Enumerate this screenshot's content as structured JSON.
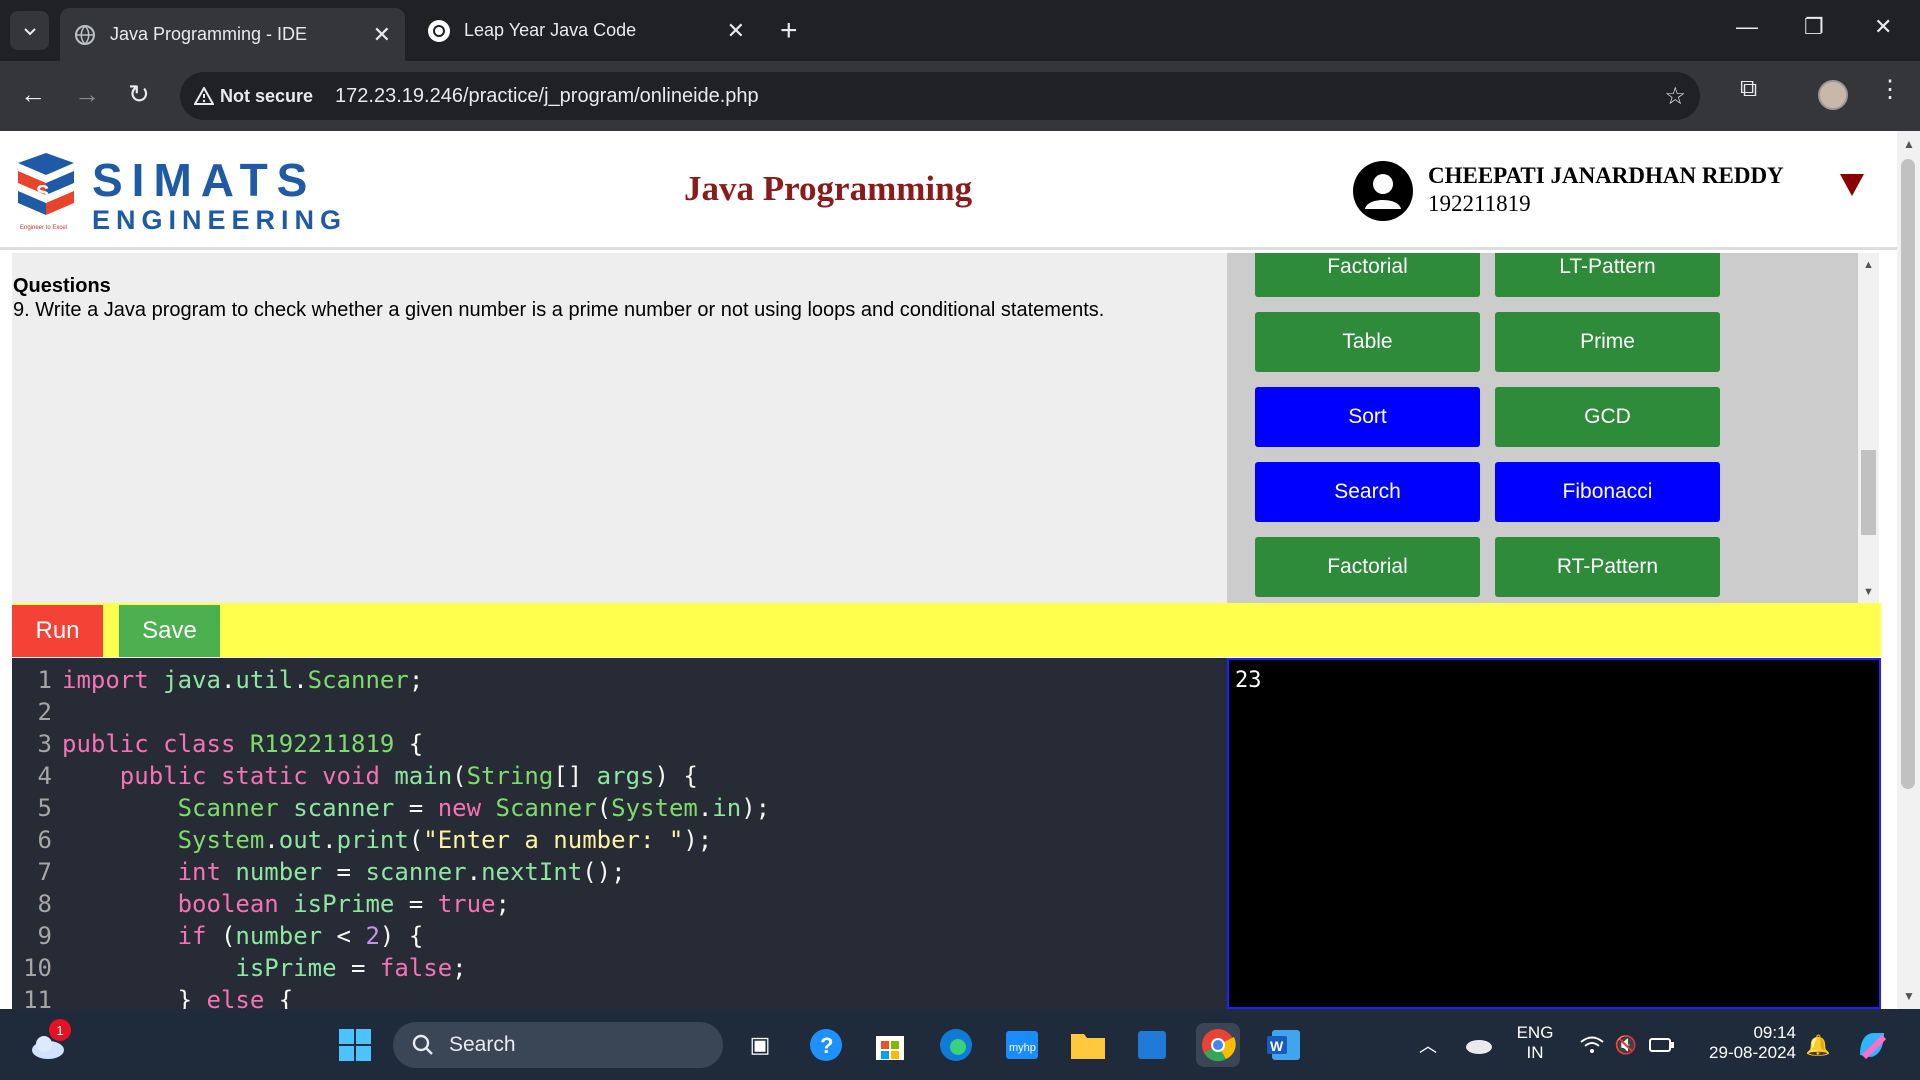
{
  "browser": {
    "tabs": [
      {
        "title": "Java Programming - IDE",
        "active": true
      },
      {
        "title": "Leap Year Java Code",
        "active": false
      }
    ],
    "security_label": "Not secure",
    "url": "172.23.19.246/practice/j_program/onlineide.php"
  },
  "header": {
    "logo_text": "SIMATS",
    "logo_subtext": "ENGINEERING",
    "logo_tagline": "Engineer to Excel",
    "title": "Java Programming",
    "user_name": "CHEEPATI JANARDHAN REDDY",
    "user_id": "192211819"
  },
  "question": {
    "heading": "Questions",
    "text": "9. Write a Java program to check whether a given number is a prime number or not using loops and conditional statements."
  },
  "program_buttons": [
    {
      "label": "Factorial",
      "color": "#2e8b3a"
    },
    {
      "label": "LT-Pattern",
      "color": "#2e8b3a"
    },
    {
      "label": "Table",
      "color": "#2e8b3a"
    },
    {
      "label": "Prime",
      "color": "#2e8b3a"
    },
    {
      "label": "Sort",
      "color": "#0000ff"
    },
    {
      "label": "GCD",
      "color": "#2e8b3a"
    },
    {
      "label": "Search",
      "color": "#0000ff"
    },
    {
      "label": "Fibonacci",
      "color": "#0000ff"
    },
    {
      "label": "Factorial",
      "color": "#2e8b3a"
    },
    {
      "label": "RT-Pattern",
      "color": "#2e8b3a"
    }
  ],
  "actions": {
    "run_label": "Run",
    "save_label": "Save"
  },
  "editor": {
    "lines": [
      {
        "n": "1",
        "html": "<span class=\"kw\">import</span> <span class=\"id\">java</span>.<span class=\"id\">util</span>.<span class=\"ty\">Scanner</span>;"
      },
      {
        "n": "2",
        "html": ""
      },
      {
        "n": "3",
        "html": "<span class=\"kw\">public</span> <span class=\"kw\">class</span> <span class=\"ty\">R192211819</span> {"
      },
      {
        "n": "4",
        "html": "    <span class=\"kw\">public</span> <span class=\"kw\">static</span> <span class=\"kw\">void</span> <span class=\"id\">main</span>(<span class=\"ty\">String</span>[] <span class=\"id\">args</span>) {"
      },
      {
        "n": "5",
        "html": "        <span class=\"ty\">Scanner</span> <span class=\"id\">scanner</span> = <span class=\"kw\">new</span> <span class=\"ty\">Scanner</span>(<span class=\"ty\">System</span>.<span class=\"id\">in</span>);"
      },
      {
        "n": "6",
        "html": "        <span class=\"ty\">System</span>.<span class=\"id\">out</span>.<span class=\"id\">print</span>(<span class=\"str\">\"Enter a number: \"</span>);"
      },
      {
        "n": "7",
        "html": "        <span class=\"kw\">int</span> <span class=\"id\">number</span> = <span class=\"id\">scanner</span>.<span class=\"id\">nextInt</span>();"
      },
      {
        "n": "8",
        "html": "        <span class=\"kw\">boolean</span> <span class=\"id\">isPrime</span> = <span class=\"kw\">true</span>;"
      },
      {
        "n": "9",
        "html": "        <span class=\"kw\">if</span> (<span class=\"id\">number</span> &lt; <span class=\"num\">2</span>) {"
      },
      {
        "n": "10",
        "html": "            <span class=\"id\">isPrime</span> = <span class=\"kw\">false</span>;"
      },
      {
        "n": "11",
        "html": "        } <span class=\"kw\">else</span> {"
      }
    ]
  },
  "output": {
    "text": "23"
  },
  "taskbar": {
    "weather_badge": "1",
    "search_label": "Search",
    "lang_line1": "ENG",
    "lang_line2": "IN",
    "time": "09:14",
    "date": "29-08-2024"
  }
}
